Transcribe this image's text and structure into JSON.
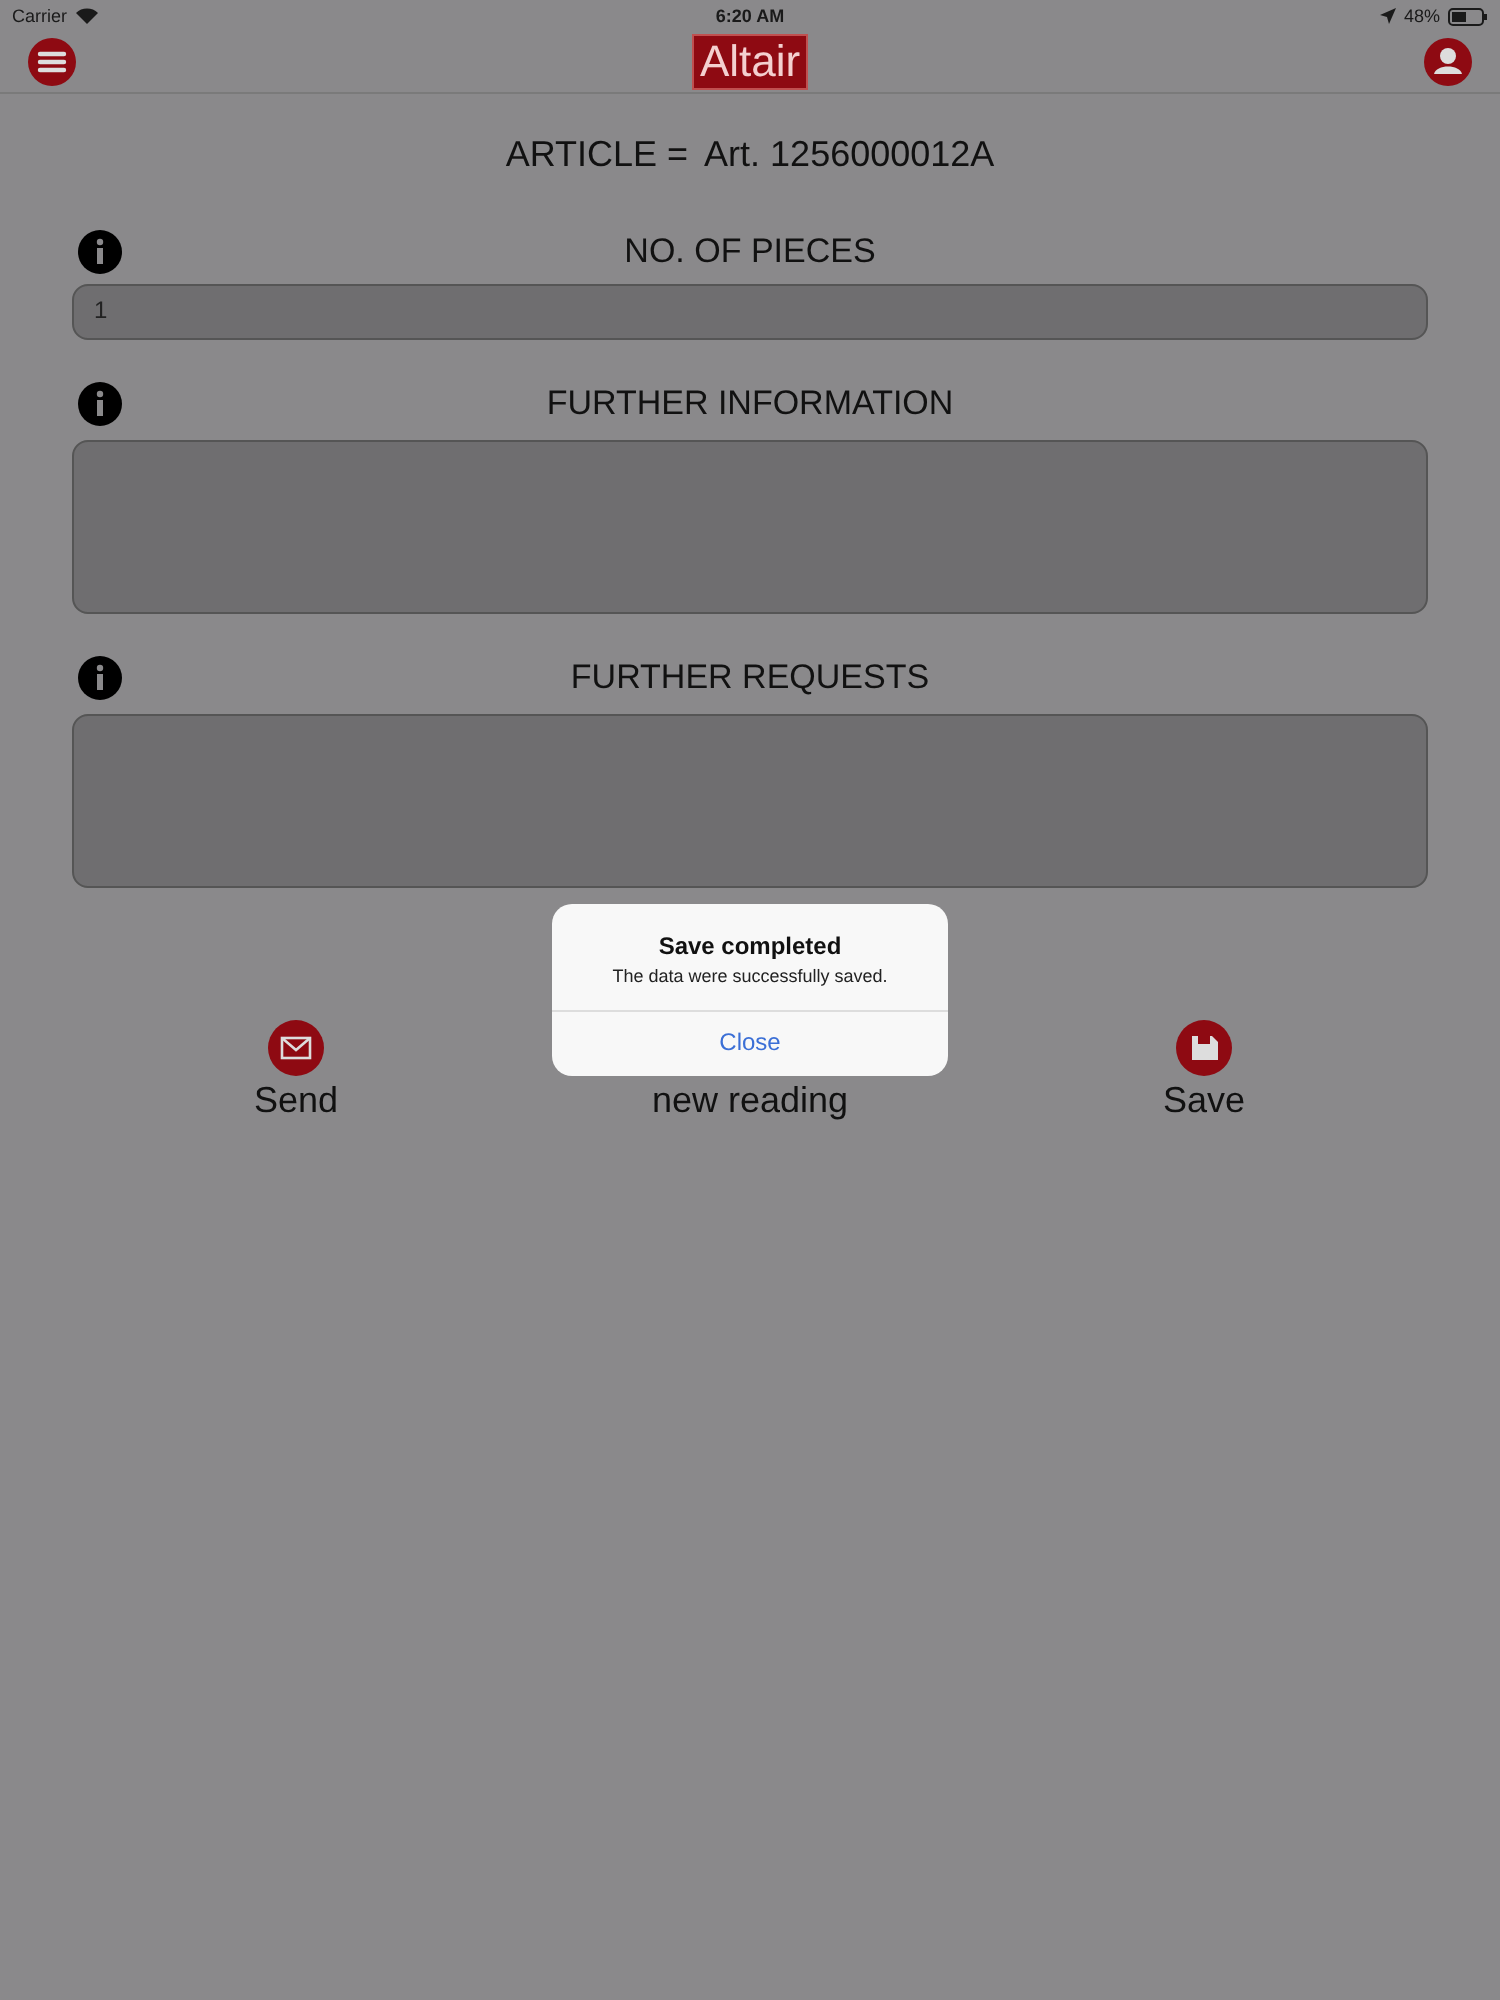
{
  "status_bar": {
    "carrier": "Carrier",
    "time": "6:20 AM",
    "battery": "48%"
  },
  "nav_bar": {
    "logo": "Altair"
  },
  "article": {
    "label": "ARTICLE =",
    "value": "Art. 1256000012A"
  },
  "fields": [
    {
      "label": "NO. OF PIECES",
      "kind": "input",
      "value": "1"
    },
    {
      "label": "FURTHER INFORMATION",
      "kind": "textarea"
    },
    {
      "label": "FURTHER REQUESTS",
      "kind": "textarea"
    }
  ],
  "actions": [
    {
      "label": "Send",
      "kind": "send"
    },
    {
      "label": "new reading",
      "kind": "none"
    },
    {
      "label": "Save",
      "kind": "save"
    }
  ],
  "alert": {
    "title": "Save completed",
    "message": "The data were successfully saved.",
    "button": "Close"
  }
}
